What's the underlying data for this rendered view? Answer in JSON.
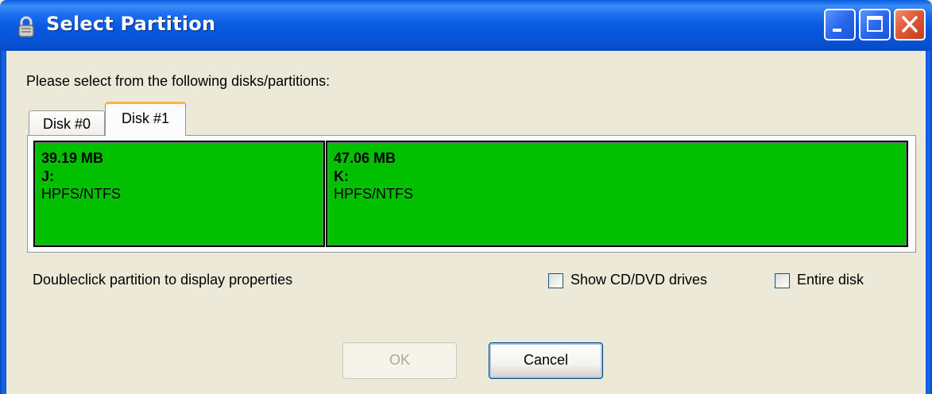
{
  "window": {
    "title": "Select Partition",
    "title_icon": "lock-icon",
    "controls": [
      "minimize-icon",
      "maximize-icon",
      "close-icon"
    ]
  },
  "prompt": "Please select from the following disks/partitions:",
  "tabs": [
    {
      "label": "Disk #0",
      "selected": false
    },
    {
      "label": "Disk #1",
      "selected": true
    }
  ],
  "partitions": [
    {
      "size": "39.19 MB",
      "letter": "J:",
      "filesystem": "HPFS/NTFS",
      "color": "#00c000"
    },
    {
      "size": "47.06 MB",
      "letter": "K:",
      "filesystem": "HPFS/NTFS",
      "color": "#00c000"
    }
  ],
  "hint": "Doubleclick partition to display properties",
  "options": {
    "show_cd_dvd": {
      "label": "Show CD/DVD drives",
      "checked": false
    },
    "entire_disk": {
      "label": "Entire disk",
      "checked": false
    }
  },
  "buttons": {
    "ok": {
      "label": "OK",
      "enabled": false
    },
    "cancel": {
      "label": "Cancel",
      "enabled": true
    }
  }
}
